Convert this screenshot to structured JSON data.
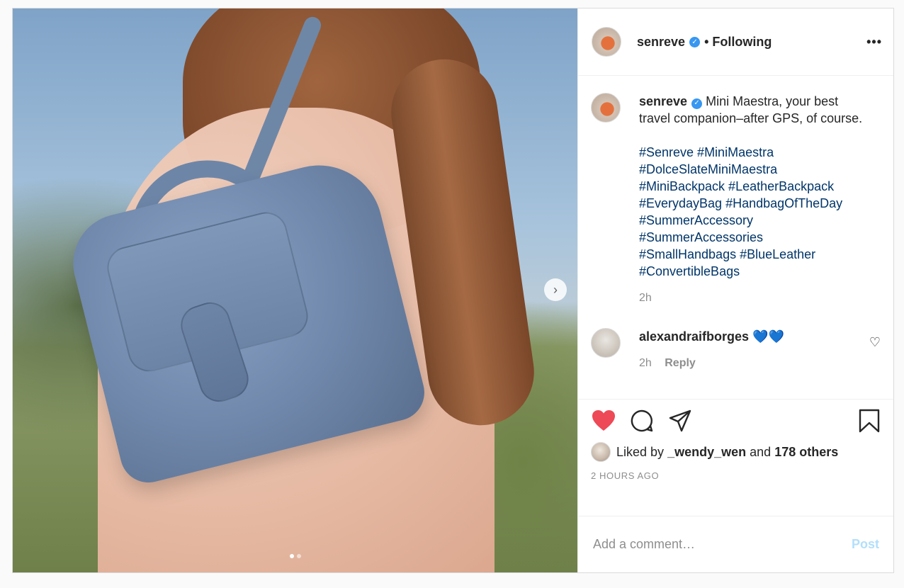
{
  "post": {
    "username": "senreve",
    "follow_status": "Following",
    "caption": "Mini Maestra, your best travel companion–after GPS, of course.",
    "hashtag_lines": [
      "#Senreve #MiniMaestra",
      "#DolceSlateMiniMaestra",
      "#MiniBackpack #LeatherBackpack",
      "#EverydayBag #HandbagOfTheDay",
      "#SummerAccessory",
      "#SummerAccessories",
      "#SmallHandbags #BlueLeather",
      "#ConvertibleBags"
    ],
    "caption_age": "2h"
  },
  "comments": [
    {
      "username": "alexandraifborges",
      "text": "💙💙",
      "age": "2h",
      "reply_label": "Reply"
    }
  ],
  "likes": {
    "liked_by_prefix": "Liked by",
    "liked_by_user": "_wendy_wen",
    "and": "and",
    "others": "178 others",
    "timestamp": "2 HOURS AGO"
  },
  "comment_box": {
    "placeholder": "Add a comment…",
    "post_label": "Post"
  },
  "colors": {
    "hashtag": "#003569",
    "like_active": "#ed4956",
    "verified": "#3897f0",
    "post_button_disabled": "#b2dffc"
  },
  "icons": [
    "heart-icon",
    "comment-icon",
    "share-icon",
    "bookmark-icon",
    "more-options-icon",
    "chevron-right-icon",
    "verified-badge-icon"
  ]
}
